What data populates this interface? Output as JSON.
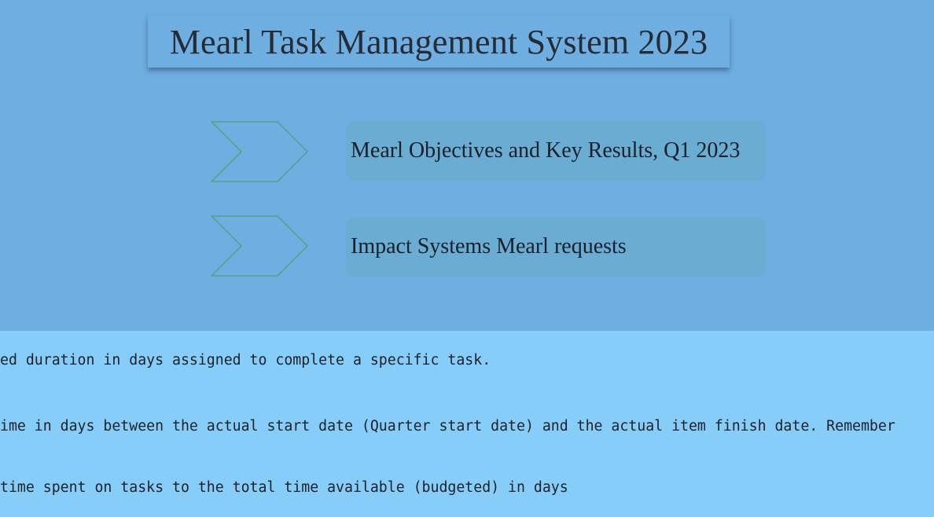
{
  "header": {
    "title": "Mearl Task Management System 2023"
  },
  "links": [
    {
      "label": "Mearl Objectives and Key Results, Q1 2023",
      "icon": "chevron-arrow-icon"
    },
    {
      "label": "Impact Systems Mearl requests",
      "icon": "chevron-arrow-icon"
    }
  ],
  "descriptions": [
    "ed duration in days assigned to complete a specific task.",
    "ime in days between the actual start date (Quarter start date) and the actual item finish date. Remember",
    "time spent on tasks to the total time available (budgeted) in days"
  ],
  "colors": {
    "top_background": "#6faee0",
    "bottom_background": "#87cdf9",
    "link_box": "#6bacd3",
    "chevron_stroke": "#4a9a5a"
  }
}
